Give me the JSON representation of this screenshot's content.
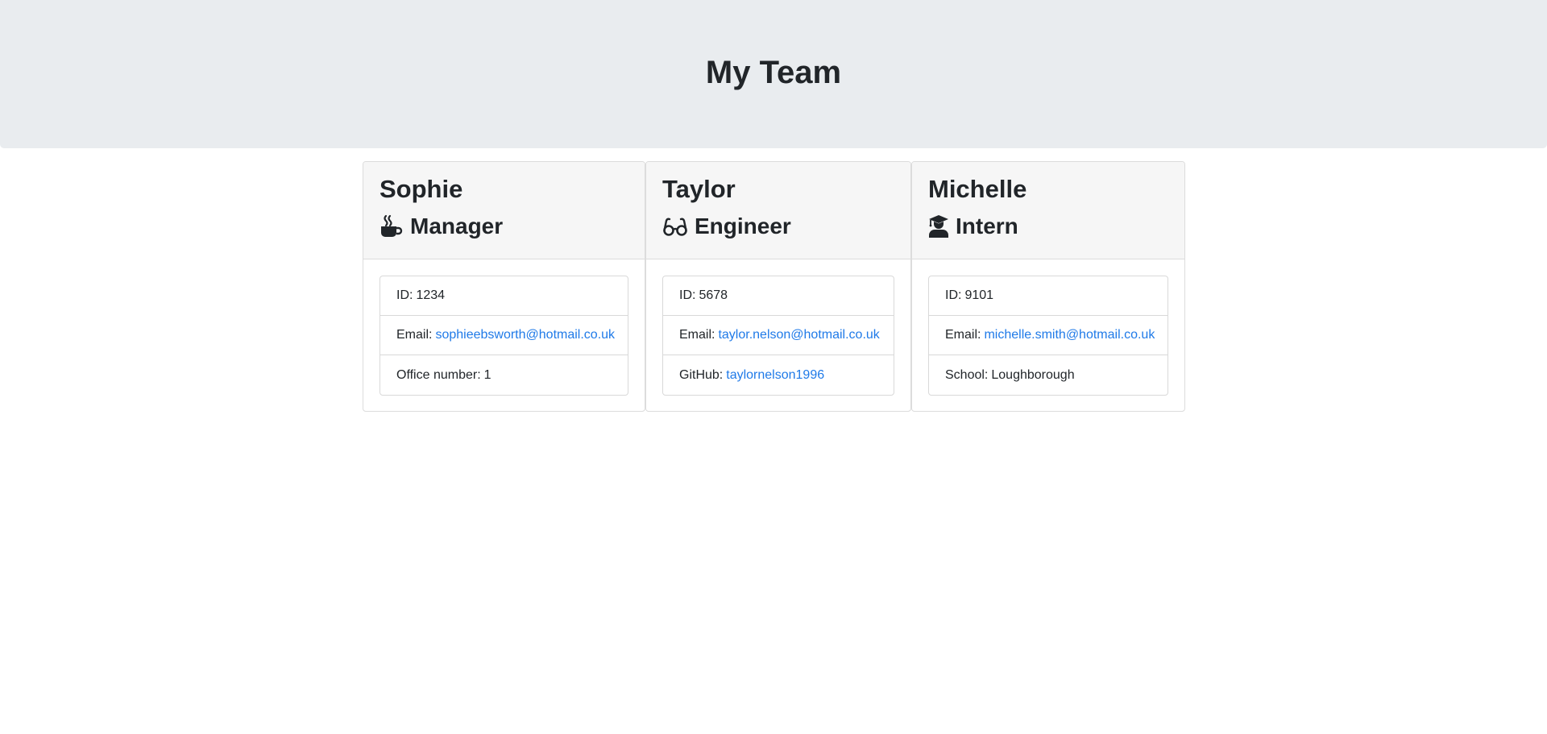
{
  "header": {
    "title": "My Team"
  },
  "team": [
    {
      "name": "Sophie",
      "role": "Manager",
      "icon": "coffee-icon",
      "id_label": "ID:",
      "id": "1234",
      "email_label": "Email:",
      "email": "sophieebsworth@hotmail.co.uk",
      "extra_label": "Office number:",
      "extra_value": "1"
    },
    {
      "name": "Taylor",
      "role": "Engineer",
      "icon": "glasses-icon",
      "id_label": "ID:",
      "id": "5678",
      "email_label": "Email:",
      "email": "taylor.nelson@hotmail.co.uk",
      "extra_label": "GitHub:",
      "extra_value": "taylornelson1996"
    },
    {
      "name": "Michelle",
      "role": "Intern",
      "icon": "graduate-icon",
      "id_label": "ID:",
      "id": "9101",
      "email_label": "Email:",
      "email": "michelle.smith@hotmail.co.uk",
      "extra_label": "School:",
      "extra_value": "Loughborough"
    }
  ],
  "colors": {
    "header_bg": "#e9ecef",
    "card_header_bg": "#f6f6f6",
    "link": "#1f7ae8",
    "text": "#212529"
  }
}
